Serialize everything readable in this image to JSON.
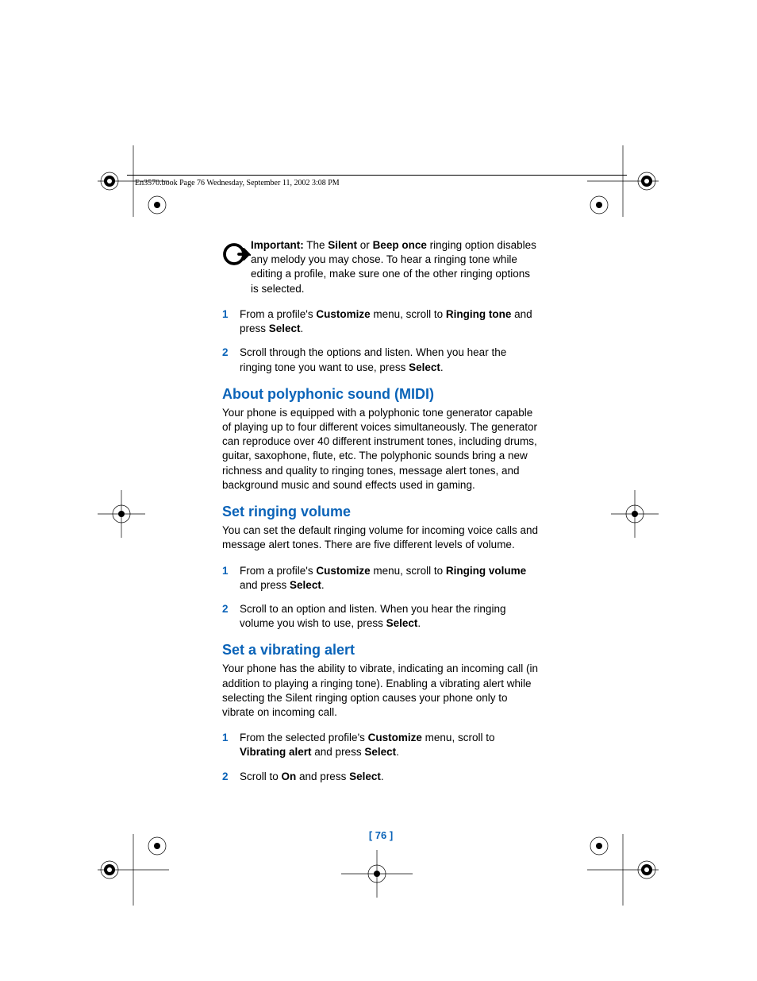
{
  "header": "En3570.book  Page 76  Wednesday, September 11, 2002  3:08 PM",
  "important": {
    "label": "Important:",
    "text_pre": " The ",
    "bold1": "Silent",
    "mid1": " or ",
    "bold2": "Beep once",
    "text_post": " ringing option disables any melody you may chose. To hear a ringing tone while editing a profile, make sure one of the other ringing options is selected."
  },
  "list1": [
    {
      "n": "1",
      "pre": "From a profile's ",
      "b1": "Customize",
      "mid": " menu, scroll to ",
      "b2": "Ringing tone",
      "post1": " and press ",
      "b3": "Select",
      "post2": "."
    },
    {
      "n": "2",
      "pre": "Scroll through the options and listen. When you hear the ringing tone you want to use, press ",
      "b1": "Select",
      "post": "."
    }
  ],
  "section1": {
    "title": "About polyphonic sound (MIDI)",
    "body": "Your phone is equipped with a polyphonic tone generator capable of playing up to four different voices simultaneously. The generator can reproduce over 40 different instrument tones, including drums, guitar, saxophone, flute, etc. The polyphonic sounds bring a new richness and quality to ringing tones, message alert tones, and background music and sound effects used in gaming."
  },
  "section2": {
    "title": "Set ringing volume",
    "body": "You can set the default ringing volume for incoming voice calls and message alert tones. There are five different levels of volume."
  },
  "list2": [
    {
      "n": "1",
      "pre": "From a profile's ",
      "b1": "Customize",
      "mid": " menu, scroll to ",
      "b2": "Ringing volume",
      "post1": " and press ",
      "b3": "Select",
      "post2": "."
    },
    {
      "n": "2",
      "pre": "Scroll to an option and listen. When you hear the ringing volume you wish to use, press ",
      "b1": "Select",
      "post": "."
    }
  ],
  "section3": {
    "title": "Set a vibrating alert",
    "body": "Your phone has the ability to vibrate, indicating an incoming call (in addition to playing a ringing tone). Enabling a vibrating alert while selecting the Silent ringing option causes your phone only to vibrate on incoming call."
  },
  "list3": [
    {
      "n": "1",
      "pre": "From the selected profile's ",
      "b1": "Customize",
      "mid": " menu, scroll to ",
      "b2": "Vibrating alert",
      "post1": " and press ",
      "b3": "Select",
      "post2": "."
    },
    {
      "n": "2",
      "pre": "Scroll to ",
      "b1": "On",
      "mid": " and press ",
      "b2": "Select",
      "post": "."
    }
  ],
  "pagenum": "[ 76 ]"
}
